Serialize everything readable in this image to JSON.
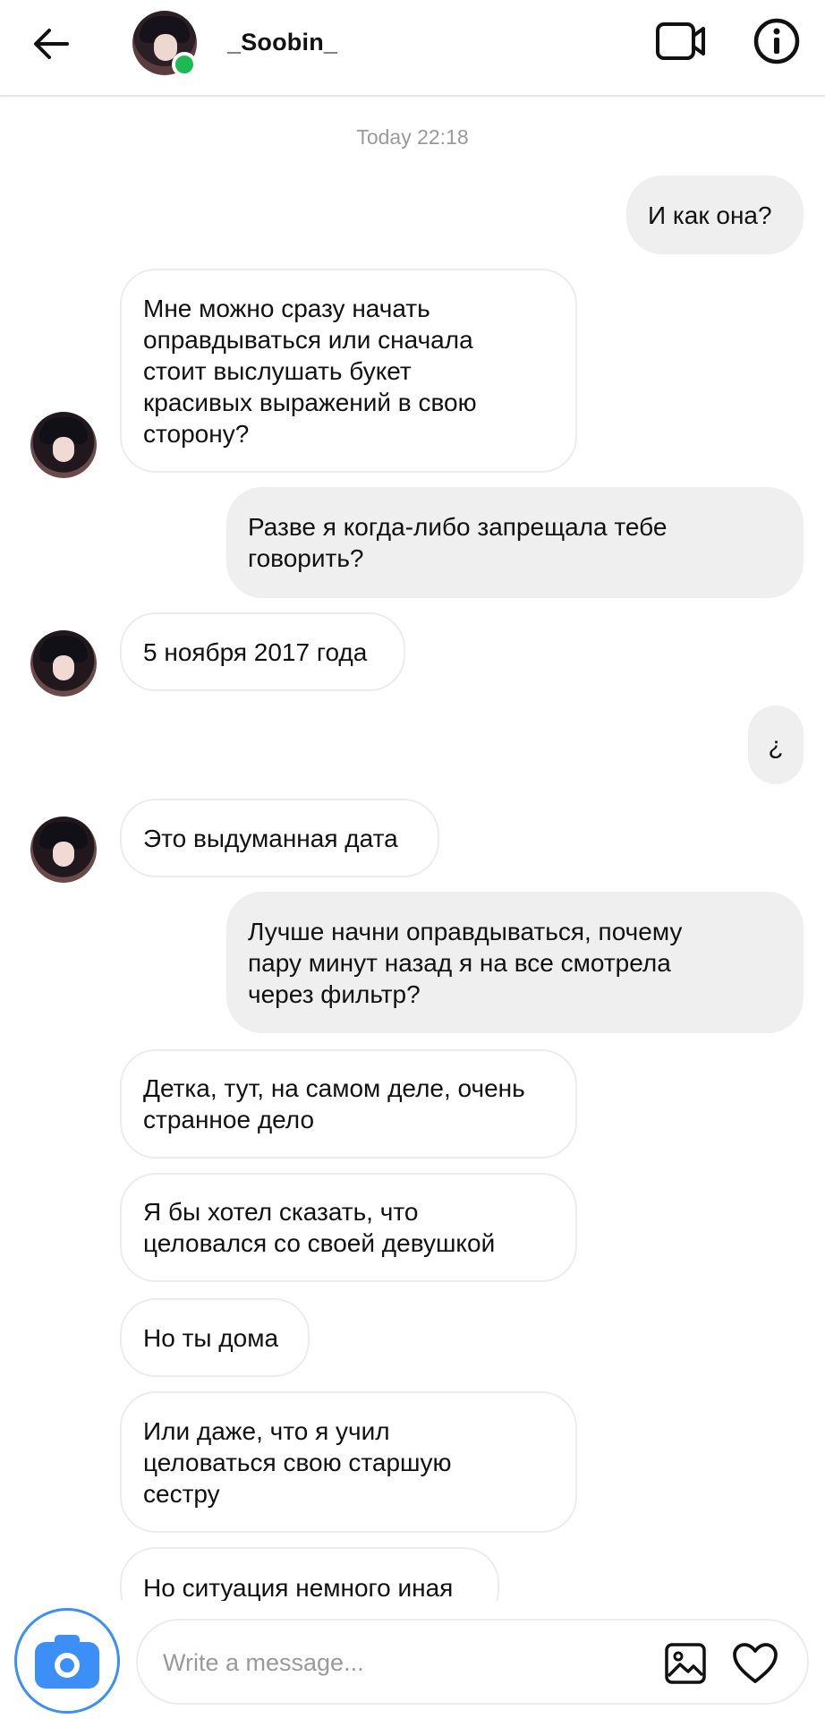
{
  "header": {
    "username": "_Soobin_",
    "online": true
  },
  "conversation": {
    "timestamp": "Today 22:18",
    "messages": [
      {
        "side": "out",
        "text": "И как она?"
      },
      {
        "side": "in",
        "text": "Мне можно сразу начать\nоправдываться или сначала\nстоит выслушать букет\nкрасивых выражений в свою\nсторону?"
      },
      {
        "side": "out",
        "text": "Разве я когда-либо запрещала тебе\nговорить?"
      },
      {
        "side": "in",
        "text": "5 ноября 2017 года"
      },
      {
        "side": "out",
        "text": "¿"
      },
      {
        "side": "in",
        "text": "Это выдуманная дата"
      },
      {
        "side": "out",
        "text": "Лучше начни оправдываться, почему\nпару минут назад я на все смотрела\nчерез фильтр?"
      },
      {
        "side": "in",
        "text": "Детка, тут, на самом деле, очень\nстранное дело"
      },
      {
        "side": "in",
        "text": "Я бы хотел сказать, что\nцеловался со своей девушкой"
      },
      {
        "side": "in",
        "text": "Но ты дома"
      },
      {
        "side": "in",
        "text": "Или даже, что я учил\nцеловаться свою старшую\nсестру"
      },
      {
        "side": "in",
        "text": "Но ситуация немного иная"
      }
    ]
  },
  "composer": {
    "placeholder": "Write a message..."
  },
  "icons": {
    "back": "arrow-left-icon",
    "video": "video-camera-icon",
    "info": "info-icon",
    "camera": "camera-icon",
    "gallery": "image-icon",
    "like": "heart-icon"
  },
  "colors": {
    "online": "#1db954",
    "camera_accent": "#3b8ff6",
    "outgoing_bubble": "#efefef",
    "incoming_border": "#ececec",
    "timestamp": "#9a9a9a"
  }
}
